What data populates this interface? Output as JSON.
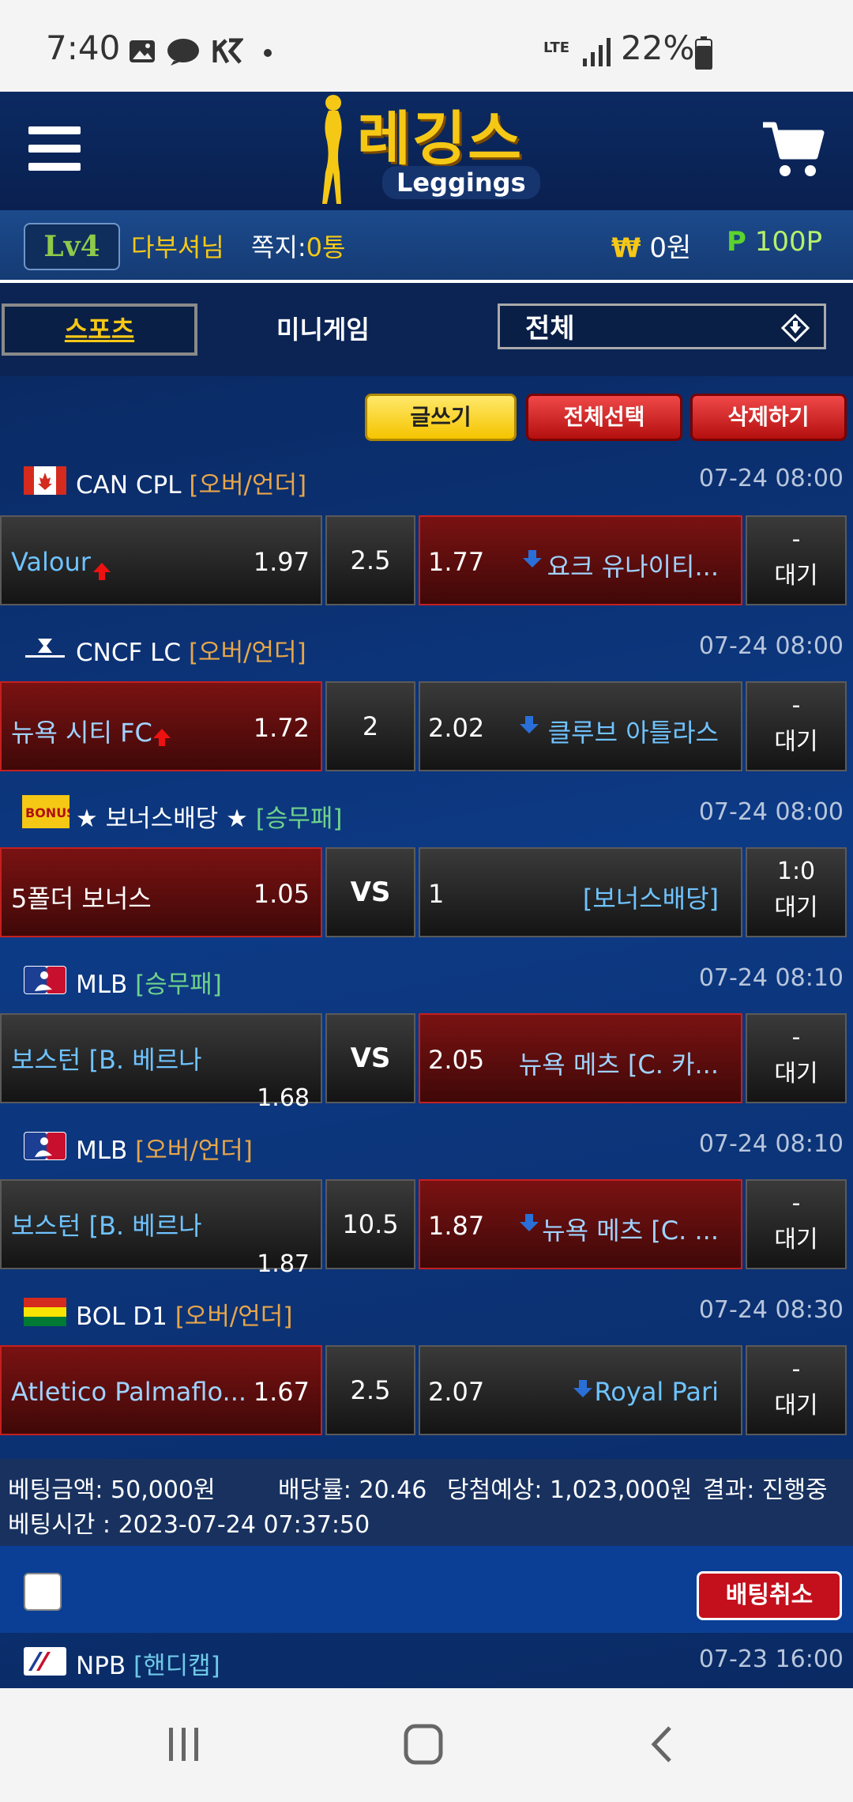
{
  "status_bar": {
    "time": "7:40",
    "network": "LTE",
    "battery": "22%"
  },
  "header": {
    "logo_text": "레깅스",
    "logo_sub": "Leggings"
  },
  "user": {
    "level_label": "Lv4",
    "name": "다부셔님",
    "notes_label": "쪽지:",
    "notes_count": "0통",
    "money_symbol": "₩",
    "money": "0원",
    "point_symbol": "P",
    "points": "100P"
  },
  "tabs": {
    "sports": "스포츠",
    "minigame": "미니게임",
    "filter_value": "전체"
  },
  "actions": {
    "write": "글쓰기",
    "select_all": "전체선택",
    "delete": "삭제하기"
  },
  "bets": [
    {
      "league": "CAN CPL",
      "type": "[오버/언더]",
      "time": "07-24 08:00",
      "home": "Valour",
      "home_odds": "1.97",
      "line": "2.5",
      "away_odds": "1.77",
      "away": "요크 유나이티...",
      "status_top": "-",
      "status": "대기"
    },
    {
      "league": "CNCF LC",
      "type": "[오버/언더]",
      "time": "07-24 08:00",
      "home": "뉴욕 시티 FC",
      "home_odds": "1.72",
      "line": "2",
      "away_odds": "2.02",
      "away": "클루브 아틀라스",
      "status_top": "-",
      "status": "대기"
    },
    {
      "league": "★ 보너스배당 ★",
      "type": "[승무패]",
      "time": "07-24 08:00",
      "home": "5폴더 보너스",
      "home_odds": "1.05",
      "line": "VS",
      "away_odds": "1",
      "away": "[보너스배당]",
      "status_top": "1:0",
      "status": "대기"
    },
    {
      "league": "MLB",
      "type": "[승무패]",
      "time": "07-24 08:10",
      "home": "보스턴 [B. 베르나",
      "home_odds": "1.68",
      "line": "VS",
      "away_odds": "2.05",
      "away": "뉴욕 메츠 [C. 카...",
      "status_top": "-",
      "status": "대기"
    },
    {
      "league": "MLB",
      "type": "[오버/언더]",
      "time": "07-24 08:10",
      "home": "보스턴 [B. 베르나",
      "home_odds": "1.87",
      "line": "10.5",
      "away_odds": "1.87",
      "away": "뉴욕 메츠 [C. ...",
      "status_top": "-",
      "status": "대기"
    },
    {
      "league": "BOL D1",
      "type": "[오버/언더]",
      "time": "07-24 08:30",
      "home": "Atletico Palmaflo...",
      "home_odds": "1.67",
      "line": "2.5",
      "away_odds": "2.07",
      "away": "Royal Pari",
      "status_top": "-",
      "status": "대기"
    }
  ],
  "summary": {
    "bet_amount": "베팅금액: 50,000원",
    "odds": "배당률: 20.46",
    "expected": "당첨예상: 1,023,000원",
    "result": "결과: 진행중",
    "bet_time": "베팅시간 : 2023-07-24 07:37:50",
    "cancel_label": "배팅취소"
  },
  "next": {
    "league": "NPB",
    "type": "[핸디캡]",
    "time": "07-23 16:00"
  },
  "colors": {
    "accent_yellow": "#f5c816",
    "red_selected": "#7a1212",
    "team_blue": "#6fc3ff"
  }
}
